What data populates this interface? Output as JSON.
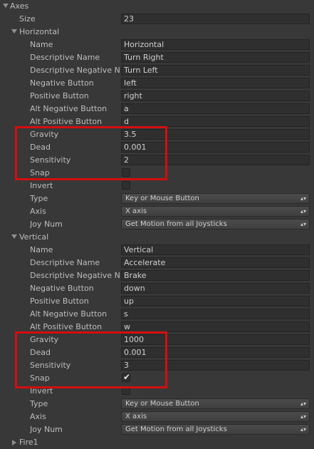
{
  "axes": {
    "label": "Axes",
    "size_label": "Size",
    "size_value": "23"
  },
  "horizontal": {
    "label": "Horizontal",
    "name_label": "Name",
    "name_value": "Horizontal",
    "desc_label": "Descriptive Name",
    "desc_value": "Turn Right",
    "desc_neg_label": "Descriptive Negative N",
    "desc_neg_value": "Turn Left",
    "neg_btn_label": "Negative Button",
    "neg_btn_value": "left",
    "pos_btn_label": "Positive Button",
    "pos_btn_value": "right",
    "alt_neg_label": "Alt Negative Button",
    "alt_neg_value": "a",
    "alt_pos_label": "Alt Positive Button",
    "alt_pos_value": "d",
    "gravity_label": "Gravity",
    "gravity_value": "3.5",
    "dead_label": "Dead",
    "dead_value": "0.001",
    "sens_label": "Sensitivity",
    "sens_value": "2",
    "snap_label": "Snap",
    "snap_checked": false,
    "invert_label": "Invert",
    "invert_checked": false,
    "type_label": "Type",
    "type_value": "Key or Mouse Button",
    "axis_label": "Axis",
    "axis_value": "X axis",
    "joy_label": "Joy Num",
    "joy_value": "Get Motion from all Joysticks"
  },
  "vertical": {
    "label": "Vertical",
    "name_label": "Name",
    "name_value": "Vertical",
    "desc_label": "Descriptive Name",
    "desc_value": "Accelerate",
    "desc_neg_label": "Descriptive Negative N",
    "desc_neg_value": "Brake",
    "neg_btn_label": "Negative Button",
    "neg_btn_value": "down",
    "pos_btn_label": "Positive Button",
    "pos_btn_value": "up",
    "alt_neg_label": "Alt Negative Button",
    "alt_neg_value": "s",
    "alt_pos_label": "Alt Positive Button",
    "alt_pos_value": "w",
    "gravity_label": "Gravity",
    "gravity_value": "1000",
    "dead_label": "Dead",
    "dead_value": "0.001",
    "sens_label": "Sensitivity",
    "sens_value": "3",
    "snap_label": "Snap",
    "snap_checked": true,
    "invert_label": "Invert",
    "invert_checked": false,
    "type_label": "Type",
    "type_value": "Key or Mouse Button",
    "axis_label": "Axis",
    "axis_value": "X axis",
    "joy_label": "Joy Num",
    "joy_value": "Get Motion from all Joysticks"
  },
  "next_item": {
    "label": "Fire1"
  },
  "popup_arrows": "▴▾",
  "check_glyph": "✔",
  "highlight_color": "#d40e0e"
}
